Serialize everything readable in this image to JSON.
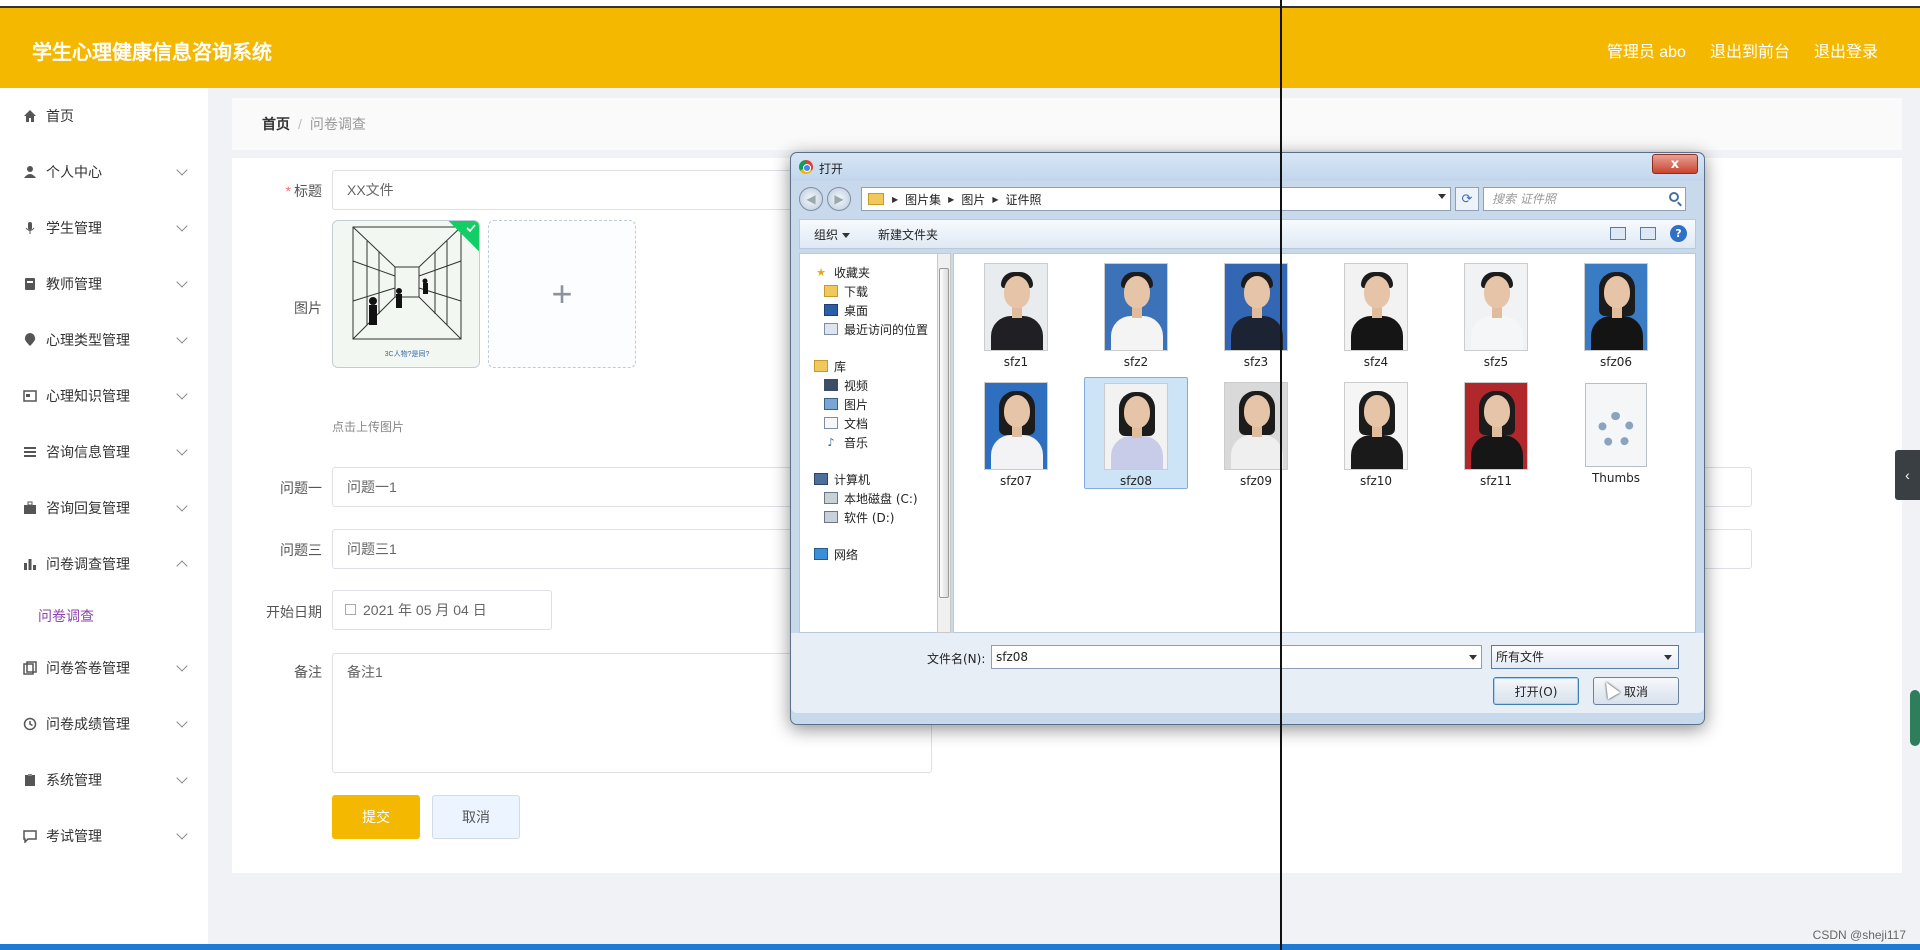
{
  "header": {
    "app_title": "学生心理健康信息咨询系统",
    "user": "管理员 abo",
    "goto_front": "退出到前台",
    "logout": "退出登录"
  },
  "sidebar": {
    "items": [
      {
        "label": "首页",
        "icon": "home-icon"
      },
      {
        "label": "个人中心",
        "icon": "user-icon"
      },
      {
        "label": "学生管理",
        "icon": "mic-icon"
      },
      {
        "label": "教师管理",
        "icon": "id-card-icon"
      },
      {
        "label": "心理类型管理",
        "icon": "location-pin-icon"
      },
      {
        "label": "心理知识管理",
        "icon": "postcard-icon"
      },
      {
        "label": "咨询信息管理",
        "icon": "list-icon"
      },
      {
        "label": "咨询回复管理",
        "icon": "suitcase-icon"
      },
      {
        "label": "问卷调查管理",
        "icon": "bar-chart-icon"
      },
      {
        "label": "问卷答卷管理",
        "icon": "copy-icon"
      },
      {
        "label": "问卷成绩管理",
        "icon": "clock-icon"
      },
      {
        "label": "系统管理",
        "icon": "clipboard-icon"
      },
      {
        "label": "考试管理",
        "icon": "chat-icon"
      }
    ],
    "sub_active": "问卷调查"
  },
  "breadcrumb": {
    "home": "首页",
    "sep": "/",
    "current": "问卷调查"
  },
  "form": {
    "title_label": "标题",
    "title_value": "XX文件",
    "image_label": "图片",
    "image_caption": "3C人物?是同?",
    "upload_tip": "点击上传图片",
    "q1_label": "问题一",
    "q1_value": "问题一1",
    "q3_label": "问题三",
    "q3_value": "问题三1",
    "date_label": "开始日期",
    "date_value": "2021 年 05 月 04 日",
    "remark_label": "备注",
    "remark_value": "备注1",
    "submit": "提交",
    "cancel": "取消"
  },
  "dialog": {
    "title": "打开",
    "close": "x",
    "path": [
      "图片集",
      "图片",
      "证件照"
    ],
    "search_placeholder": "搜索 证件照",
    "toolbar": {
      "organize": "组织",
      "new_folder": "新建文件夹"
    },
    "nav": {
      "favorites": "收藏夹",
      "downloads": "下载",
      "desktop": "桌面",
      "recent": "最近访问的位置",
      "library": "库",
      "videos": "视频",
      "pictures": "图片",
      "documents": "文档",
      "music": "音乐",
      "computer": "计算机",
      "disk_c": "本地磁盘 (C:)",
      "disk_d": "软件 (D:)",
      "network": "网络"
    },
    "files": [
      {
        "name": "sfz1",
        "bg": "#e8ecef",
        "body": "#1f1f24",
        "hair": "short"
      },
      {
        "name": "sfz2",
        "bg": "#3c72b8",
        "body": "#f4f4f4",
        "hair": "short"
      },
      {
        "name": "sfz3",
        "bg": "#3367b4",
        "body": "#1c2433",
        "hair": "short"
      },
      {
        "name": "sfz4",
        "bg": "#f2f2f2",
        "body": "#151515",
        "hair": "short"
      },
      {
        "name": "sfz5",
        "bg": "#f0f2f4",
        "body": "#f4f6f8",
        "hair": "short"
      },
      {
        "name": "sfz06",
        "bg": "#3a7cc4",
        "body": "#141414",
        "hair": "long"
      },
      {
        "name": "sfz07",
        "bg": "#2f6fbf",
        "body": "#f3f3f6",
        "hair": "long"
      },
      {
        "name": "sfz08",
        "bg": "#f2f2f2",
        "body": "#c9cce8",
        "hair": "long"
      },
      {
        "name": "sfz09",
        "bg": "#d9d9d9",
        "body": "#f0efef",
        "hair": "long"
      },
      {
        "name": "sfz10",
        "bg": "#f5f5f5",
        "body": "#1a1a1a",
        "hair": "long"
      },
      {
        "name": "sfz11",
        "bg": "#b0282c",
        "body": "#161616",
        "hair": "long"
      },
      {
        "name": "Thumbs",
        "type": "system-file"
      }
    ],
    "filename_label": "文件名(N):",
    "filename_value": "sfz08",
    "filetype": "所有文件",
    "open": "打开(O)",
    "cancel": "取消"
  },
  "side_tab": "‹",
  "watermark": "CSDN @sheji117"
}
